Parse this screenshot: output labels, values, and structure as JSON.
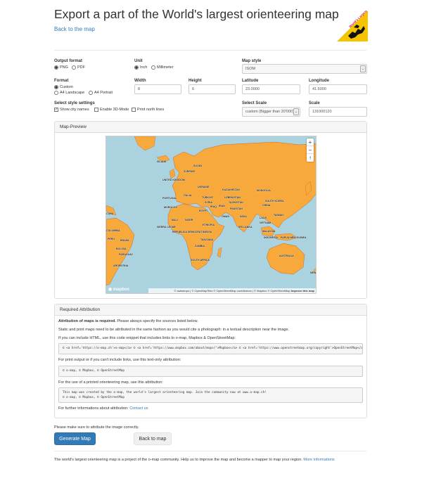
{
  "page": {
    "title": "Export a part of the World's largest orienteering map",
    "back_link": "Back to the map",
    "logo_text": "World's Largest Orienteering Map"
  },
  "form": {
    "output_format": {
      "label": "Output format",
      "options": [
        "PNG",
        "PDF"
      ],
      "selected": "PNG"
    },
    "unit": {
      "label": "Unit",
      "options": [
        "Inch",
        "Millimeter"
      ],
      "selected": "Inch"
    },
    "map_style": {
      "label": "Map style",
      "value": "ISOM"
    },
    "format": {
      "label": "Format",
      "options": [
        "Custom",
        "A4 Landscape",
        "A4 Portrait"
      ],
      "selected": "Custom"
    },
    "width": {
      "label": "Width",
      "value": "8"
    },
    "height": {
      "label": "Height",
      "value": "6"
    },
    "latitude": {
      "label": "Latitude",
      "value": "23.0000"
    },
    "longitude": {
      "label": "Longitude",
      "value": "41.5000"
    },
    "style_settings": {
      "label": "Select style settings",
      "options": [
        {
          "label": "Show city names",
          "checked": true
        },
        {
          "label": "Enable 3D-Mode",
          "checked": false
        },
        {
          "label": "Print north lines",
          "checked": false
        }
      ]
    },
    "select_scale": {
      "label": "Select Scale",
      "value": "custom (Bigger than 20'000)"
    },
    "scale": {
      "label": "Scale",
      "value": "131000120"
    }
  },
  "preview": {
    "title": "Map-Preview",
    "zoom_in": "+",
    "zoom_out": "−",
    "compass": "↑",
    "mapbox_logo": "mapbox",
    "attribution": "© swisstopo | © OpenMapTiles © OpenStreetMap contributors | © Mapbox © OpenStreetMap",
    "improve": "Improve this map",
    "labels": [
      "ISLAND",
      "SUOMI",
      "SVERIGE",
      "UNITED KINGDOM",
      "ITALIA",
      "UKRAINE",
      "KAZAKHSTAN",
      "MONGOLIA",
      "PORTUGAL",
      "TÜRKIYE",
      "UZBEKISTAN",
      "SOUTH KOREA",
      "MOROCCO",
      "SYRIA",
      "IRAQ",
      "IRAN",
      "TAJIKISTAN",
      "CHINA",
      "PAKISTAN",
      "EGYPT",
      "OMAN",
      "INDIA",
      "TAIWAN",
      "CUBA",
      "MALI",
      "NIGER",
      "LAOS",
      "VIETNAM",
      "SIERRA LEONE",
      "ETHIOPIA",
      "SRI LANKA",
      "COLOMBIA",
      "REPÚBLICA DEMOCRÁTICA",
      "KENYA",
      "MALAYSIA",
      "PERU",
      "BRASIL",
      "TANZANIA",
      "INDONESIA",
      "PAPUA NEW GUINEA",
      "BOLIVIA",
      "ZAMBIA",
      "PARAGUAY",
      "AUSTRALIA",
      "ARGENTINA",
      "SOUTH AFRICA",
      "NEW"
    ]
  },
  "attribution_panel": {
    "title": "Required Attribution",
    "required_bold": "Attribution of maps is required.",
    "required_rest": " Please always specify the sources listed below.",
    "static_text": "Static and print maps need to be attributed in the same fashion as you would cite a photograph: in a textual description near the image.",
    "html_intro": "If you can include HTML, use this code snippet that includes links to o-map, Mapbox & OpenStreetMap:",
    "html_code": "© <a href='https://o-map.ch'>o-map</a> © <a href='https://www.mapbox.com/about/maps/'>Mapbox</a> © <a href='https://www.openstreetmap.org/copyright'>OpenStreetMap</a>",
    "text_intro": "For print output or if you can't include links, use this text-only attribution:",
    "text_code": "© o-map, © Mapbox, © OpenStreetMap",
    "printed_intro": "For the use of a printed orienteering map, use this attribution:",
    "printed_code_line1": "This map was created by the o-map, the world's largest orienteering map. Join the community now at www.o-map.ch!",
    "printed_code_line2": "© o-map, © Mapbox, © OpenStreetMap",
    "further_text": "For further informations about attribution: ",
    "contact_link": "Contact us"
  },
  "footer": {
    "notice": "Please make sure to attribute the image correctly.",
    "generate_button": "Generate Map",
    "back_button": "Back to map",
    "community_text": "The world's largest orienteering map is a project of the o-map community. Help us to improve the map and become a mapper to map your region.",
    "more_link": "More Informations"
  },
  "colors": {
    "link": "#337ab7",
    "primary_button": "#337ab7",
    "land": "#f7a93b",
    "water": "#aad3df",
    "logo_yellow": "#f5c400"
  }
}
